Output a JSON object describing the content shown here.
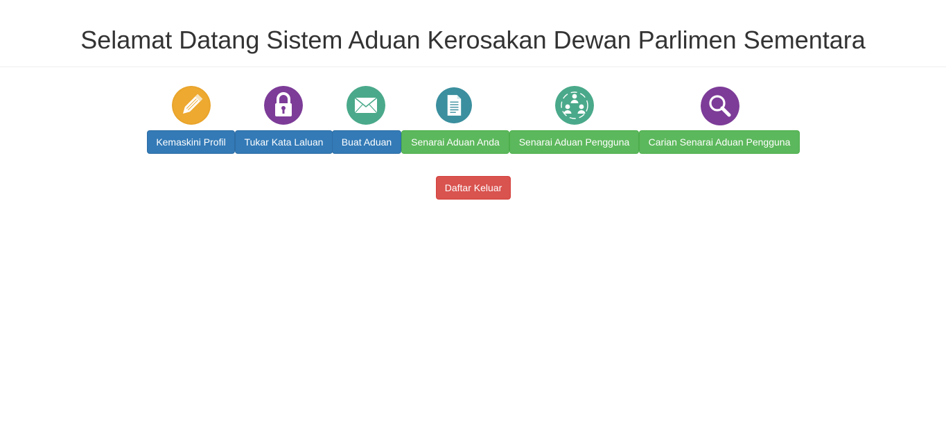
{
  "header": {
    "title": "Selamat Datang Sistem Aduan Kerosakan Dewan Parlimen Sementara"
  },
  "menu": [
    {
      "label": "Kemaskini Profil",
      "icon": "pencil-icon",
      "icon_color": "#E9A42B",
      "style": "primary"
    },
    {
      "label": "Tukar Kata Laluan",
      "icon": "lock-icon",
      "icon_color": "#7D3C98",
      "style": "primary"
    },
    {
      "label": "Buat Aduan",
      "icon": "envelope-icon",
      "icon_color": "#4AA98A",
      "style": "primary"
    },
    {
      "label": "Senarai Aduan Anda",
      "icon": "document-icon",
      "icon_color": "#3B8F9E",
      "style": "success"
    },
    {
      "label": "Senarai Aduan Pengguna",
      "icon": "users-cycle-icon",
      "icon_color": "#4AA98A",
      "style": "success"
    },
    {
      "label": "Carian Senarai Aduan Pengguna",
      "icon": "search-icon",
      "icon_color": "#7D3C98",
      "style": "success"
    }
  ],
  "logout": {
    "label": "Daftar Keluar",
    "style": "danger"
  },
  "colors": {
    "primary": "#337ab7",
    "success": "#5cb85c",
    "danger": "#d9534f"
  }
}
